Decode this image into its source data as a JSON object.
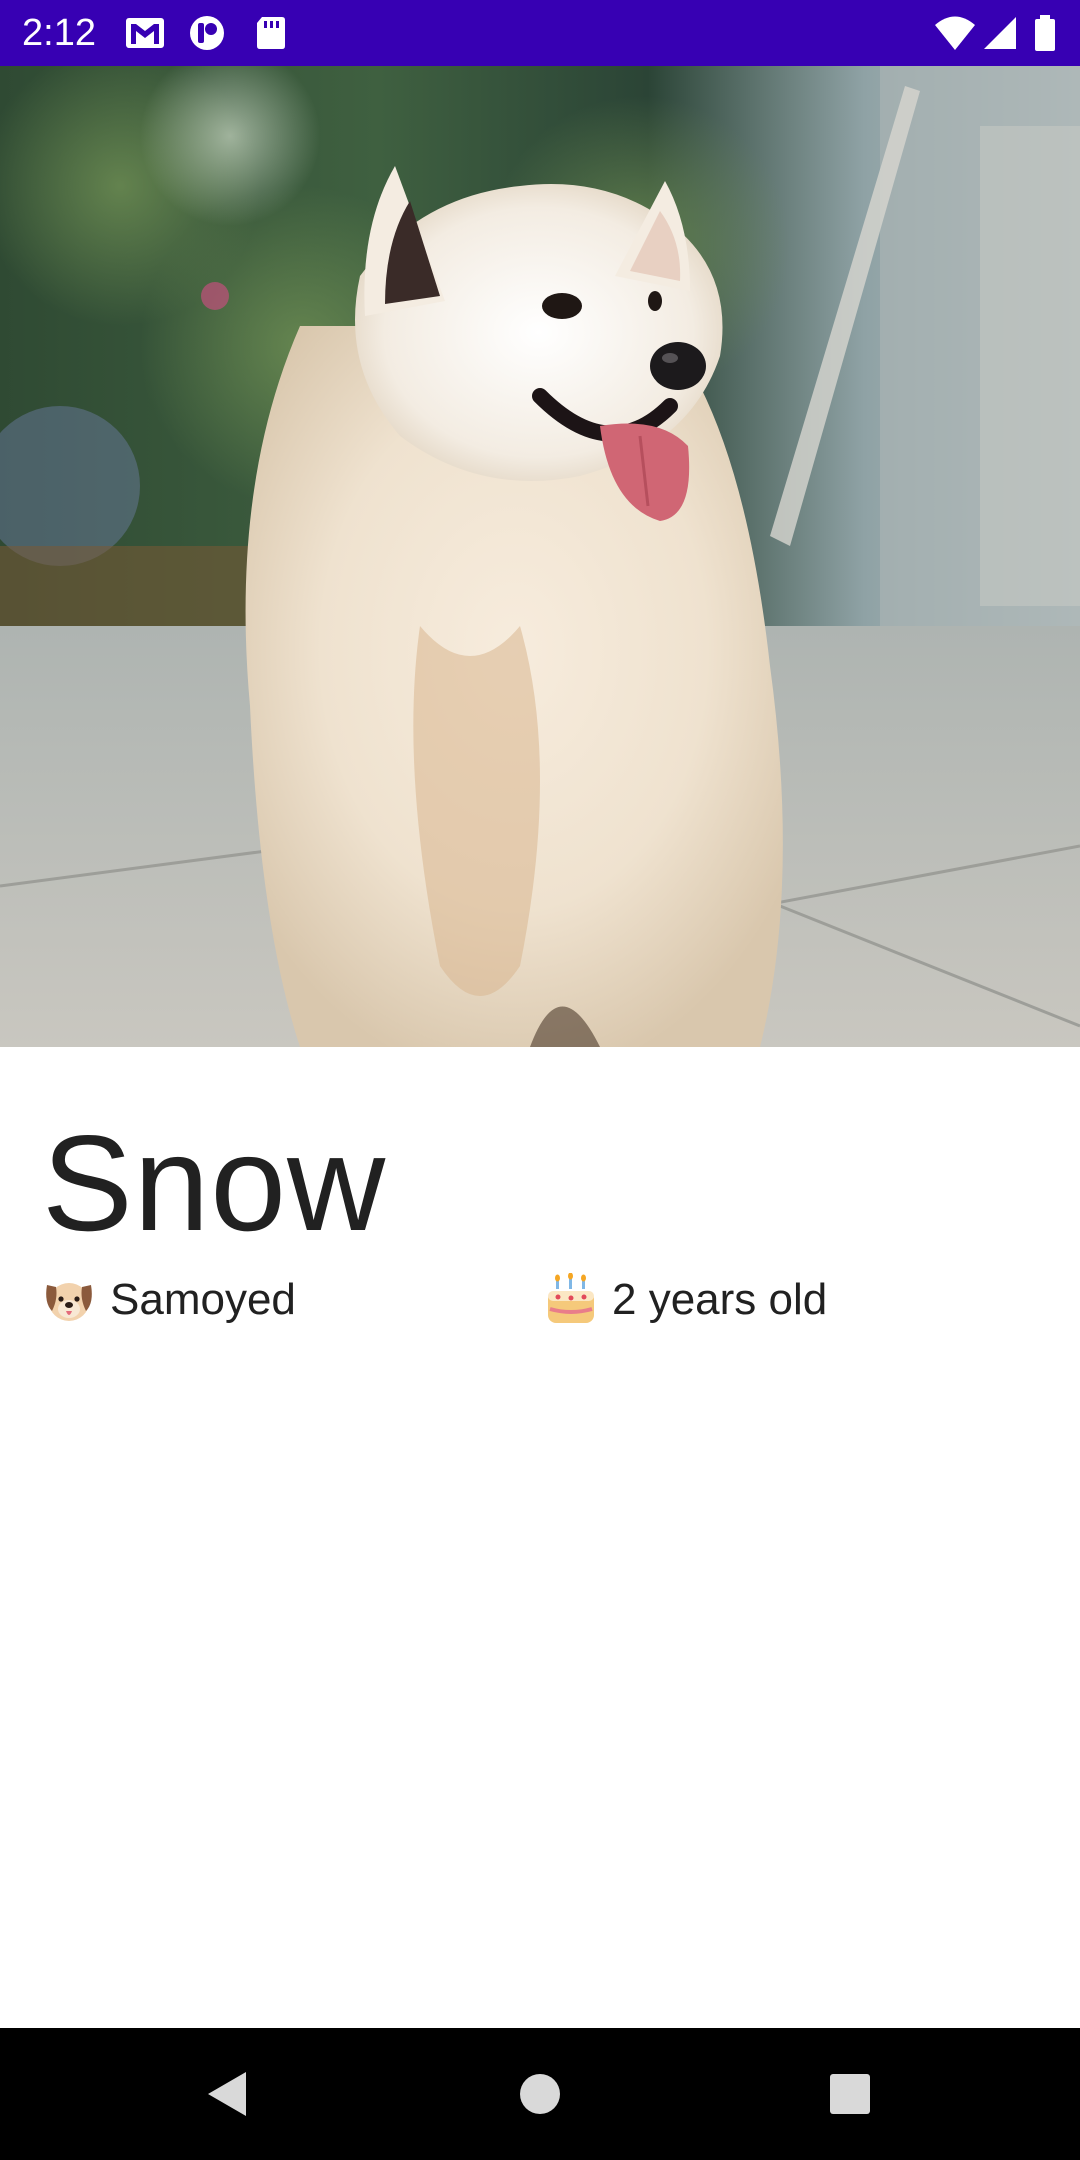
{
  "status_bar": {
    "time": "2:12",
    "left_icons": [
      "gmail-icon",
      "app-notification-icon",
      "sd-card-icon"
    ],
    "right_icons": [
      "wifi-icon",
      "cell-signal-icon",
      "battery-icon"
    ],
    "background_color": "#3700b3"
  },
  "hero": {
    "image_subject": "white Samoyed dog sitting outdoors"
  },
  "pet": {
    "name": "Snow",
    "breed_icon": "dog-face-emoji",
    "breed": "Samoyed",
    "age_icon": "birthday-cake-emoji",
    "age": "2 years old"
  },
  "nav_bar": {
    "buttons": [
      "back-button",
      "home-button",
      "recents-button"
    ]
  }
}
